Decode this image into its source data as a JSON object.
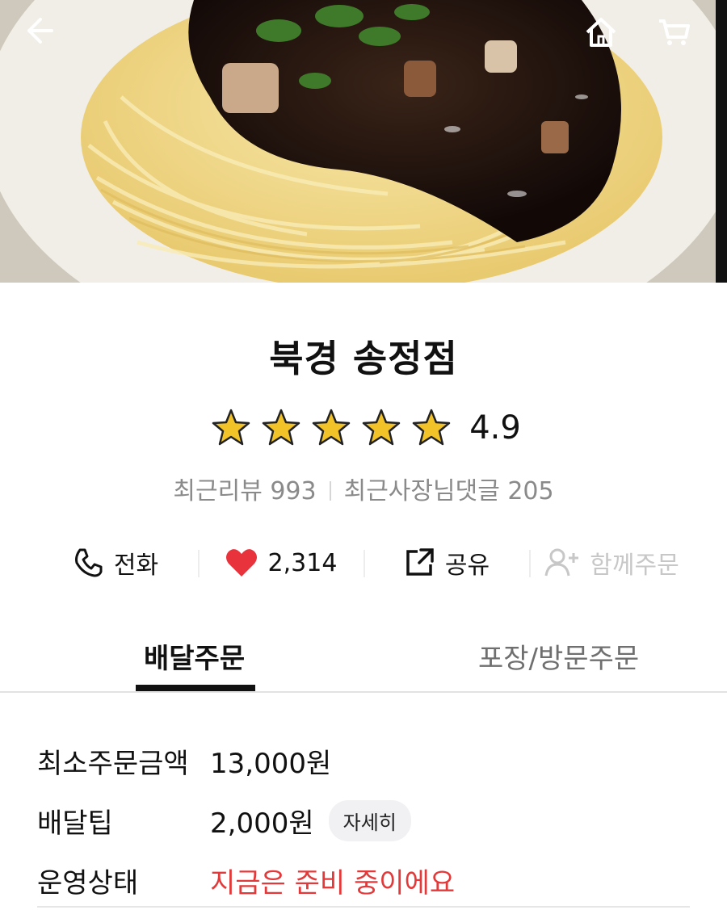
{
  "store": {
    "name": "북경 송정점",
    "rating": "4.9",
    "stars": 5,
    "recent_reviews_label": "최근리뷰 993",
    "owner_comments_label": "최근사장님댓글 205"
  },
  "header": {
    "back_icon": "arrow-left-icon",
    "home_icon": "home-icon",
    "cart_icon": "cart-icon"
  },
  "actions": {
    "call_label": "전화",
    "like_count": "2,314",
    "share_label": "공유",
    "group_order_label": "함께주문"
  },
  "tabs": {
    "delivery": "배달주문",
    "pickup": "포장/방문주문"
  },
  "info": {
    "min_order_label": "최소주문금액",
    "min_order_value": "13,000원",
    "delivery_tip_label": "배달팁",
    "delivery_tip_value": "2,000원",
    "detail_button": "자세히",
    "status_label": "운영상태",
    "status_value": "지금은 준비 중이에요"
  },
  "colors": {
    "accent_red": "#e23a3a",
    "heart": "#e8323c",
    "star_fill": "#f2c229"
  }
}
